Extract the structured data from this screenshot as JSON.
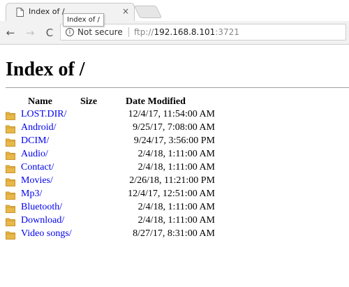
{
  "browser": {
    "tab": {
      "title": "Index of /",
      "close_glyph": "×",
      "favicon": "document-icon"
    },
    "tooltip": "Index of /",
    "nav": {
      "back": "←",
      "forward": "→",
      "reload": "C"
    },
    "address_bar": {
      "security_icon": "info-icon",
      "security_glyph": "i",
      "security_label": "Not secure",
      "url_scheme": "ftp://",
      "url_host": "192.168.8.101",
      "url_port": ":3721"
    }
  },
  "page": {
    "title": "Index of /",
    "headers": {
      "name": "Name",
      "size": "Size",
      "date": "Date Modified"
    },
    "entries": [
      {
        "name": "LOST.DIR/",
        "size": "",
        "date": "12/4/17, 11:54:00 AM"
      },
      {
        "name": "Android/",
        "size": "",
        "date": "9/25/17, 7:08:00 AM"
      },
      {
        "name": "DCIM/",
        "size": "",
        "date": "9/24/17, 3:56:00 PM"
      },
      {
        "name": "Audio/",
        "size": "",
        "date": "2/4/18, 1:11:00 AM"
      },
      {
        "name": "Contact/",
        "size": "",
        "date": "2/4/18, 1:11:00 AM"
      },
      {
        "name": "Movies/",
        "size": "",
        "date": "2/26/18, 11:21:00 PM"
      },
      {
        "name": "Mp3/",
        "size": "",
        "date": "12/4/17, 12:51:00 AM"
      },
      {
        "name": "Bluetooth/",
        "size": "",
        "date": "2/4/18, 1:11:00 AM"
      },
      {
        "name": "Download/",
        "size": "",
        "date": "2/4/18, 1:11:00 AM"
      },
      {
        "name": "Video songs/",
        "size": "",
        "date": "8/27/17, 8:31:00 AM"
      }
    ]
  },
  "colors": {
    "link": "#0000ee",
    "folder": "#e8b84a",
    "folder_dark": "#c9952a"
  }
}
